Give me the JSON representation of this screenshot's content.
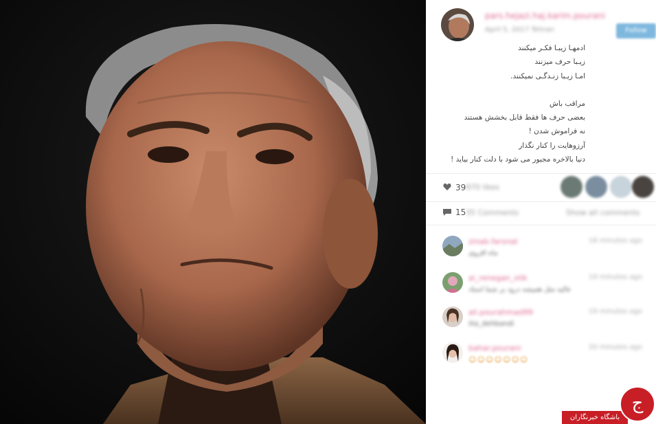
{
  "post": {
    "username": "pars.hejazi.haj.karim.pourani",
    "date": "April 5, 2017 Tehran",
    "follow_label": "Follow",
    "caption_lines_1": [
      "ادمهـا زیبـا فکـر میکنند",
      "زیـبا حرف میزنند",
      "امـا زیـبا زنـدگـی نمیکنند."
    ],
    "caption_lines_2": [
      "مراقب باش",
      "بعضی حرف ها فقط قابل بخشش هستند",
      "نه فراموش شدن !",
      "آرزوهایت را کنار نگذار",
      "دنیا بالاخره مجبور می شود با دلت کنار بیاید !"
    ],
    "likes_count": "39",
    "likes_suffix": "970 likes",
    "comments_count": "15",
    "comments_suffix": "35 Comments",
    "show_all_label": "Show all comments"
  },
  "comments": [
    {
      "user": "zinab.farsnat",
      "time": "18 minutes ago",
      "text": "ماه اقروی",
      "kind": "text"
    },
    {
      "user": "ai_renegan_olik",
      "time": "19 minutes ago",
      "text": "عالیه مثل همیشه درود بر شما استاد",
      "kind": "text"
    },
    {
      "user": "ali.pourahmad99",
      "time": "19 minutes ago",
      "text": "ilia_dehbandi",
      "kind": "text"
    },
    {
      "user": "bahar.pourani",
      "time": "20 minutes ago",
      "text": "☺☺☺☺☺☺☺",
      "kind": "emoji"
    }
  ],
  "brand": {
    "name": "باشگاه خبرنگاران",
    "glyph": "ج",
    "color": "#c81e26"
  },
  "colors": {
    "username_pink": "#e06a8f",
    "follow_blue": "#7fb8de"
  },
  "icons": {
    "likes": "heart-icon",
    "comments": "speech-bubble-icon"
  }
}
